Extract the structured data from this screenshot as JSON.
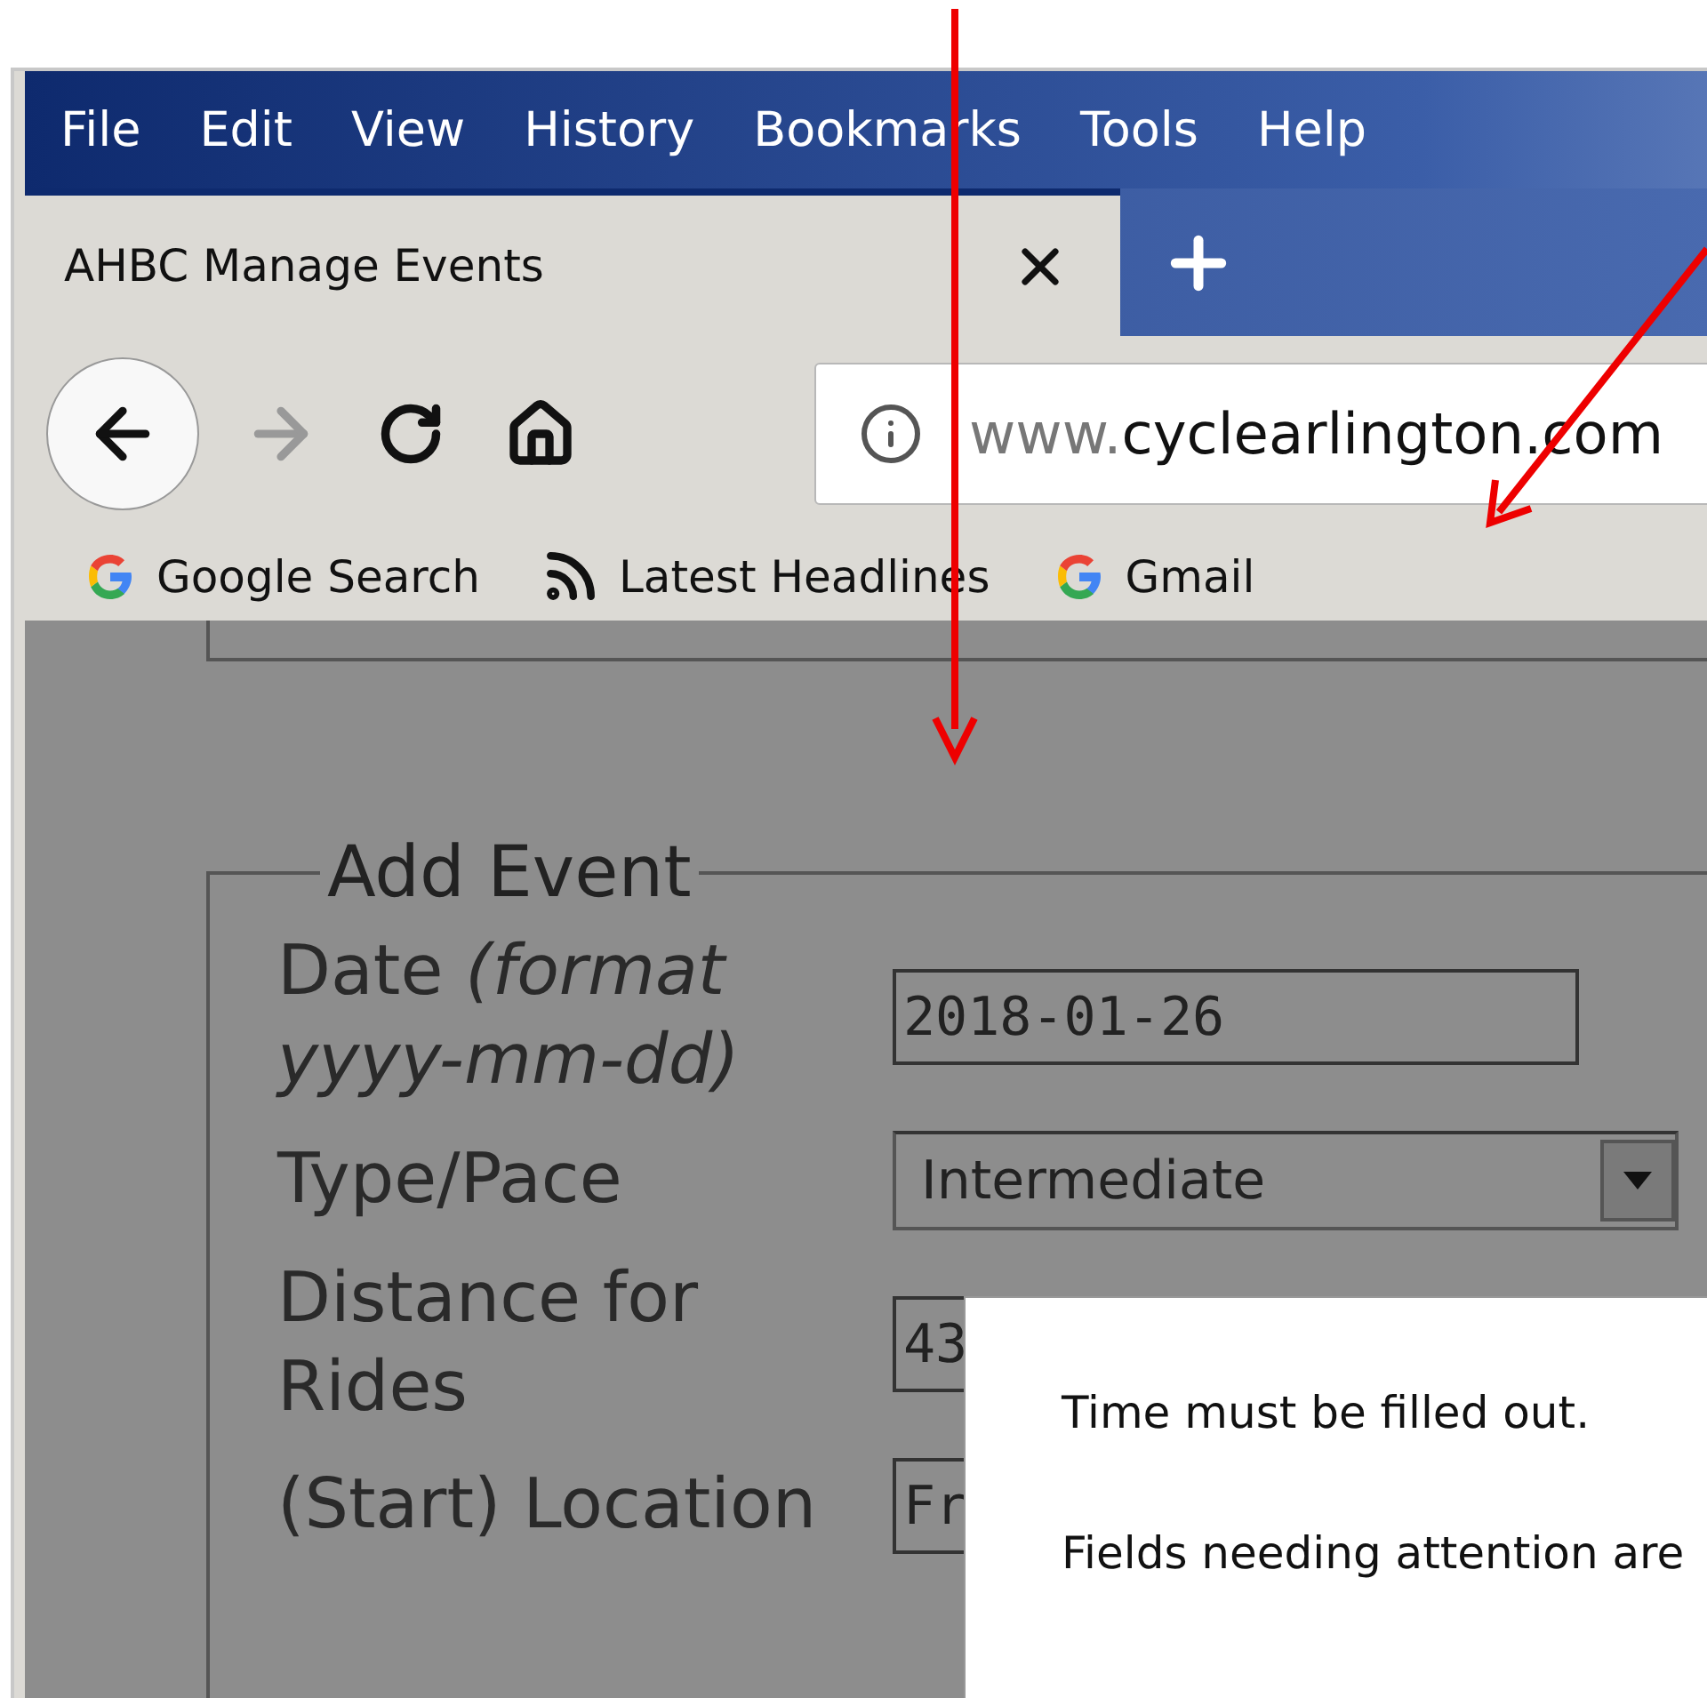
{
  "menu": [
    "File",
    "Edit",
    "View",
    "History",
    "Bookmarks",
    "Tools",
    "Help"
  ],
  "tabs": [
    {
      "title": "AHBC Manage Events",
      "selected": true
    }
  ],
  "address": {
    "prefix": "www.",
    "domain": "cyclearlington.com"
  },
  "bookmarks": [
    {
      "label": "Google Search",
      "kind": "google"
    },
    {
      "label": "Latest Headlines",
      "kind": "feed"
    },
    {
      "label": "Gmail",
      "kind": "google"
    }
  ],
  "form": {
    "legend": "Add Event",
    "fields": [
      {
        "label": "Date *(format yyyy-mm-dd)*",
        "kind": "text",
        "value": "2018-01-26"
      },
      {
        "label": "Type/Pace",
        "kind": "select",
        "value": "Intermediate"
      },
      {
        "label": "Distance for Rides",
        "kind": "text",
        "value": "43"
      },
      {
        "label": "(Start) Location",
        "kind": "text",
        "value": "Fr"
      }
    ]
  },
  "dialog": {
    "messages": [
      "Time must be filled out.",
      "Fields needing attention are"
    ]
  }
}
